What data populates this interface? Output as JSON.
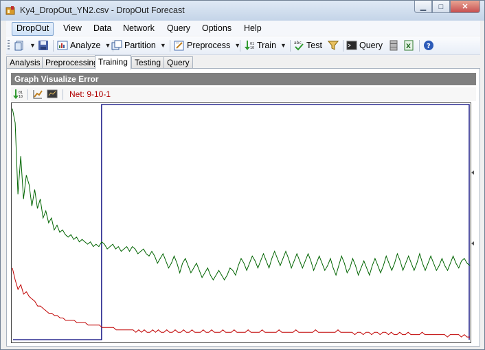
{
  "window": {
    "title": "Ky4_DropOut_YN2.csv - DropOut Forecast",
    "controls": {
      "minimize": "▁",
      "maximize": "□",
      "close": "✕"
    }
  },
  "menu": [
    "DropOut",
    "View",
    "Data",
    "Network",
    "Query",
    "Options",
    "Help"
  ],
  "toolbar": {
    "analyze": "Analyze",
    "partition": "Partition",
    "preprocess": "Preprocess",
    "train": "Train",
    "test": "Test",
    "query": "Query"
  },
  "tabs": [
    "Analysis",
    "Preprocessing",
    "Training",
    "Testing",
    "Query"
  ],
  "active_tab": "Training",
  "panel": {
    "header": "Graph Visualize Error",
    "net_label": "Net: 9-10-1"
  },
  "colors": {
    "train_error_line": "#006400",
    "validation_error_line": "#c00000",
    "partition_box": "#00007a"
  },
  "chart_data": {
    "type": "line",
    "grid": false,
    "legend": "none",
    "series": [
      {
        "color": "#006400",
        "values": [
          0.98,
          0.92,
          0.62,
          0.78,
          0.6,
          0.7,
          0.66,
          0.57,
          0.64,
          0.56,
          0.6,
          0.52,
          0.55,
          0.5,
          0.52,
          0.47,
          0.49,
          0.46,
          0.47,
          0.45,
          0.44,
          0.45,
          0.43,
          0.44,
          0.42,
          0.43,
          0.42,
          0.41,
          0.42,
          0.4,
          0.41,
          0.4,
          0.42,
          0.41,
          0.39,
          0.4,
          0.41,
          0.39,
          0.4,
          0.38,
          0.39,
          0.4,
          0.38,
          0.4,
          0.39,
          0.37,
          0.38,
          0.39,
          0.37,
          0.36,
          0.38,
          0.36,
          0.33,
          0.35,
          0.37,
          0.34,
          0.31,
          0.33,
          0.36,
          0.33,
          0.29,
          0.33,
          0.35,
          0.32,
          0.29,
          0.31,
          0.33,
          0.3,
          0.27,
          0.29,
          0.31,
          0.28,
          0.26,
          0.28,
          0.3,
          0.28,
          0.26,
          0.28,
          0.31,
          0.3,
          0.28,
          0.32,
          0.35,
          0.33,
          0.3,
          0.33,
          0.36,
          0.34,
          0.31,
          0.34,
          0.37,
          0.34,
          0.31,
          0.35,
          0.38,
          0.35,
          0.32,
          0.35,
          0.38,
          0.35,
          0.31,
          0.34,
          0.37,
          0.34,
          0.31,
          0.34,
          0.37,
          0.34,
          0.3,
          0.33,
          0.36,
          0.33,
          0.3,
          0.32,
          0.35,
          0.31,
          0.28,
          0.32,
          0.36,
          0.33,
          0.29,
          0.31,
          0.35,
          0.32,
          0.28,
          0.31,
          0.34,
          0.31,
          0.28,
          0.32,
          0.35,
          0.32,
          0.29,
          0.32,
          0.36,
          0.33,
          0.3,
          0.33,
          0.37,
          0.34,
          0.3,
          0.33,
          0.36,
          0.33,
          0.3,
          0.33,
          0.37,
          0.33,
          0.3,
          0.33,
          0.36,
          0.33,
          0.3,
          0.32,
          0.35,
          0.32,
          0.3,
          0.33,
          0.36,
          0.33,
          0.31,
          0.34,
          0.35,
          0.33,
          0.32
        ]
      },
      {
        "color": "#c00000",
        "values": [
          0.31,
          0.26,
          0.22,
          0.24,
          0.2,
          0.21,
          0.19,
          0.18,
          0.17,
          0.15,
          0.15,
          0.14,
          0.13,
          0.12,
          0.12,
          0.11,
          0.11,
          0.1,
          0.1,
          0.09,
          0.09,
          0.09,
          0.09,
          0.08,
          0.08,
          0.08,
          0.08,
          0.07,
          0.07,
          0.07,
          0.07,
          0.07,
          0.06,
          0.06,
          0.06,
          0.06,
          0.06,
          0.05,
          0.05,
          0.05,
          0.05,
          0.05,
          0.05,
          0.05,
          0.04,
          0.05,
          0.04,
          0.05,
          0.04,
          0.04,
          0.05,
          0.04,
          0.05,
          0.04,
          0.04,
          0.05,
          0.04,
          0.04,
          0.05,
          0.04,
          0.04,
          0.05,
          0.04,
          0.04,
          0.05,
          0.04,
          0.04,
          0.04,
          0.05,
          0.04,
          0.04,
          0.05,
          0.04,
          0.04,
          0.04,
          0.05,
          0.04,
          0.04,
          0.04,
          0.05,
          0.04,
          0.04,
          0.04,
          0.04,
          0.05,
          0.04,
          0.04,
          0.04,
          0.04,
          0.05,
          0.04,
          0.04,
          0.04,
          0.04,
          0.04,
          0.05,
          0.04,
          0.04,
          0.04,
          0.04,
          0.04,
          0.05,
          0.04,
          0.04,
          0.04,
          0.04,
          0.04,
          0.04,
          0.05,
          0.04,
          0.04,
          0.04,
          0.04,
          0.04,
          0.04,
          0.04,
          0.05,
          0.04,
          0.04,
          0.04,
          0.04,
          0.04,
          0.03,
          0.04,
          0.04,
          0.03,
          0.04,
          0.04,
          0.03,
          0.04,
          0.04,
          0.03,
          0.04,
          0.04,
          0.03,
          0.04,
          0.03,
          0.03,
          0.04,
          0.03,
          0.03,
          0.04,
          0.03,
          0.03,
          0.03,
          0.03,
          0.04,
          0.03,
          0.03,
          0.03,
          0.03,
          0.03,
          0.03,
          0.03,
          0.03,
          0.02,
          0.03,
          0.03,
          0.03,
          0.03,
          0.02,
          0.03,
          0.02,
          0.02
        ]
      }
    ],
    "xlim": [
      0,
      171
    ],
    "ylim": [
      0,
      1.0
    ],
    "partition_fraction": 0.195
  }
}
